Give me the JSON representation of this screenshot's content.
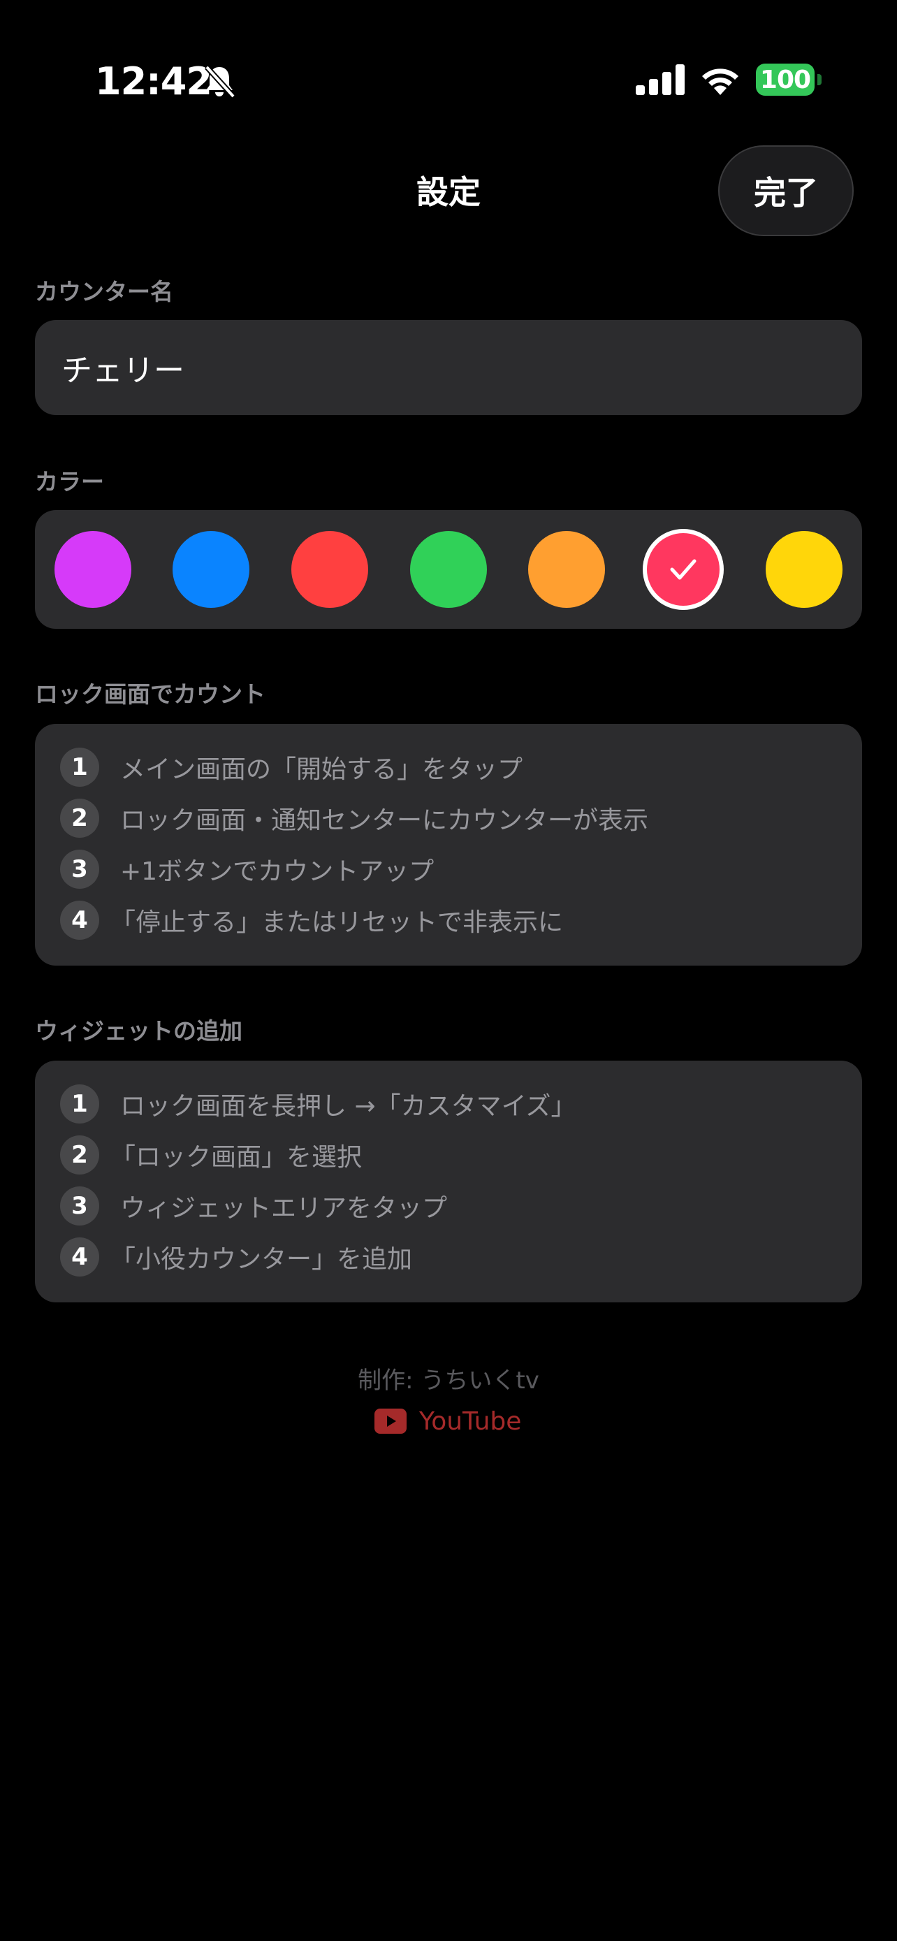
{
  "status_bar": {
    "time": "12:42",
    "battery": "100"
  },
  "header": {
    "title": "設定",
    "done_label": "完了"
  },
  "counter_name": {
    "label": "カウンター名",
    "value": "チェリー"
  },
  "color": {
    "label": "カラー",
    "options": [
      "#d63af9",
      "#0a84ff",
      "#ff4040",
      "#30d158",
      "#ff9f30",
      "#ff375f",
      "#ffd60a"
    ],
    "selected_index": 5
  },
  "lock_screen": {
    "label": "ロック画面でカウント",
    "steps": [
      {
        "num": "1",
        "text": "メイン画面の「開始する」をタップ"
      },
      {
        "num": "2",
        "text": "ロック画面・通知センターにカウンターが表示"
      },
      {
        "num": "3",
        "text": "+1ボタンでカウントアップ"
      },
      {
        "num": "4",
        "text": "「停止する」またはリセットで非表示に"
      }
    ]
  },
  "widget": {
    "label": "ウィジェットの追加",
    "steps": [
      {
        "num": "1",
        "text": "ロック画面を長押し →「カスタマイズ」"
      },
      {
        "num": "2",
        "text": "「ロック画面」を選択"
      },
      {
        "num": "3",
        "text": "ウィジェットエリアをタップ"
      },
      {
        "num": "4",
        "text": "「小役カウンター」を追加"
      }
    ]
  },
  "footer": {
    "credit": "制作: うちいくtv",
    "youtube_label": "YouTube"
  },
  "icons": {
    "bell": "bell-slash-icon",
    "signal": "cellular-signal-icon",
    "wifi": "wifi-icon",
    "check": "checkmark-icon",
    "youtube": "youtube-icon"
  }
}
